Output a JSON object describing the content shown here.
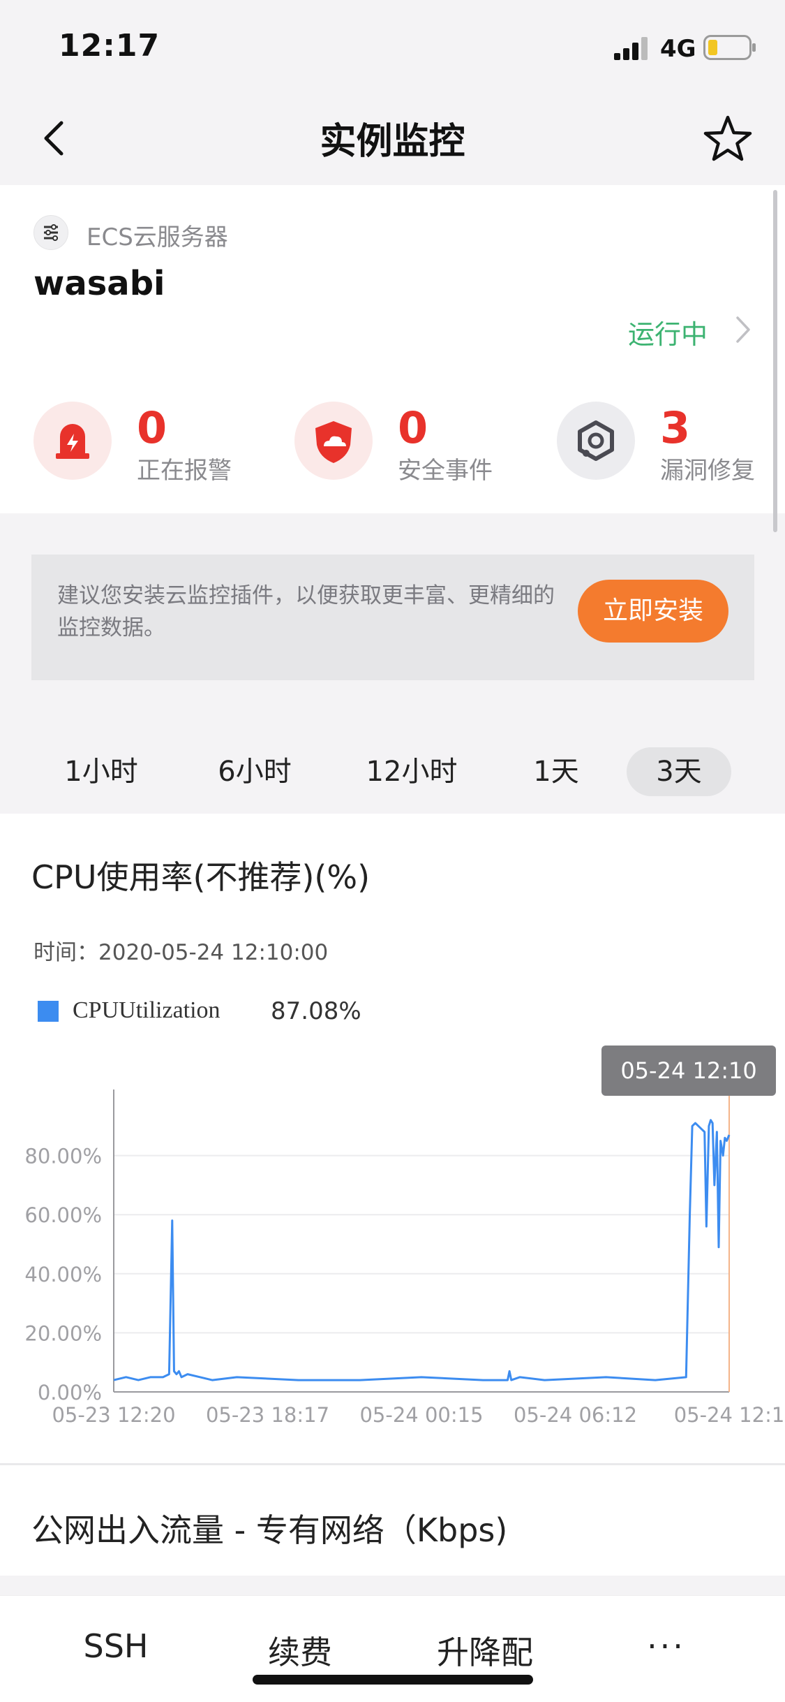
{
  "status_bar": {
    "time": "12:17",
    "network": "4G"
  },
  "nav": {
    "title": "实例监控"
  },
  "instance": {
    "type": "ECS云服务器",
    "name": "wasabi",
    "status": "运行中"
  },
  "stats": [
    {
      "value": "0",
      "label": "正在报警"
    },
    {
      "value": "0",
      "label": "安全事件"
    },
    {
      "value": "3",
      "label": "漏洞修复"
    }
  ],
  "banner": {
    "text": "建议您安装云监控插件，以便获取更丰富、更精细的监控数据。",
    "button": "立即安装"
  },
  "time_tabs": [
    {
      "label": "1小时",
      "active": false
    },
    {
      "label": "6小时",
      "active": false
    },
    {
      "label": "12小时",
      "active": false
    },
    {
      "label": "1天",
      "active": false
    },
    {
      "label": "3天",
      "active": true
    }
  ],
  "cpu_chart": {
    "title": "CPU使用率(不推荐)(%)",
    "time_label": "时间：2020-05-24 12:10:00",
    "legend_name": "CPUUtilization",
    "legend_value": "87.08%",
    "tooltip": "05-24 12:10"
  },
  "chart_data": {
    "type": "line",
    "title": "CPU使用率(不推荐)(%)",
    "xlabel": "",
    "ylabel": "",
    "ylim": [
      0,
      100
    ],
    "yticks": [
      "0.00%",
      "20.00%",
      "40.00%",
      "60.00%",
      "80.00%"
    ],
    "xticks": [
      "05-23 12:20",
      "05-23 18:17",
      "05-24 00:15",
      "05-24 06:12",
      "05-24 12:1"
    ],
    "series": [
      {
        "name": "CPUUtilization",
        "color": "#3c8cf0",
        "x": [
          0,
          2,
          4,
          6,
          8,
          9,
          9.5,
          9.8,
          10.2,
          10.6,
          11,
          12,
          14,
          16,
          20,
          30,
          40,
          50,
          60,
          64,
          64.3,
          64.6,
          66,
          70,
          80,
          88,
          93,
          93.6,
          94,
          94.5,
          95,
          95.5,
          96,
          96.3,
          96.7,
          97,
          97.3,
          97.6,
          98,
          98.3,
          98.6,
          99,
          99.3,
          99.6,
          100
        ],
        "y": [
          4,
          5,
          4,
          5,
          5,
          6,
          58,
          7,
          6,
          7,
          5,
          6,
          5,
          4,
          5,
          4,
          4,
          5,
          4,
          4,
          7,
          4,
          5,
          4,
          5,
          4,
          5,
          60,
          90,
          91,
          90,
          89,
          88,
          56,
          90,
          92,
          91,
          70,
          88,
          49,
          85,
          80,
          86,
          85,
          87
        ]
      }
    ],
    "grid": true,
    "cursor_x": 100
  },
  "section2": {
    "title": "公网出入流量 - 专有网络（Kbps)"
  },
  "bottom_bar": {
    "ssh": "SSH",
    "renew": "续费",
    "resize": "升降配",
    "more": "···"
  },
  "colors": {
    "accent": "#f47b2e",
    "alert": "#e8322b",
    "running": "#3cb371",
    "series": "#3c8cf0"
  }
}
